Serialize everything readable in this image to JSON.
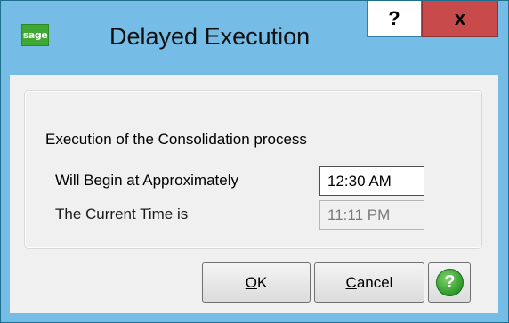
{
  "window": {
    "title": "Delayed Execution",
    "app_icon_text": "sage",
    "help_glyph": "?",
    "close_glyph": "x"
  },
  "group": {
    "heading": "Execution of the Consolidation process",
    "begin_label": "Will Begin at Approximately",
    "begin_value": "12:30 AM",
    "current_label": "The Current Time is",
    "current_value": "11:11 PM"
  },
  "buttons": {
    "ok_mnemonic": "O",
    "ok_rest": "K",
    "cancel_mnemonic": "C",
    "cancel_rest": "ancel",
    "help_glyph": "?"
  },
  "icons": {
    "app": "sage-logo-icon",
    "help": "question-mark-icon",
    "close": "close-icon",
    "help_circle": "green-question-circle-icon"
  },
  "colors": {
    "titlebar": "#75bde6",
    "close": "#c84a4a",
    "dialog_bg": "#f0f0f0",
    "help_icon": "#2e9a2a"
  }
}
